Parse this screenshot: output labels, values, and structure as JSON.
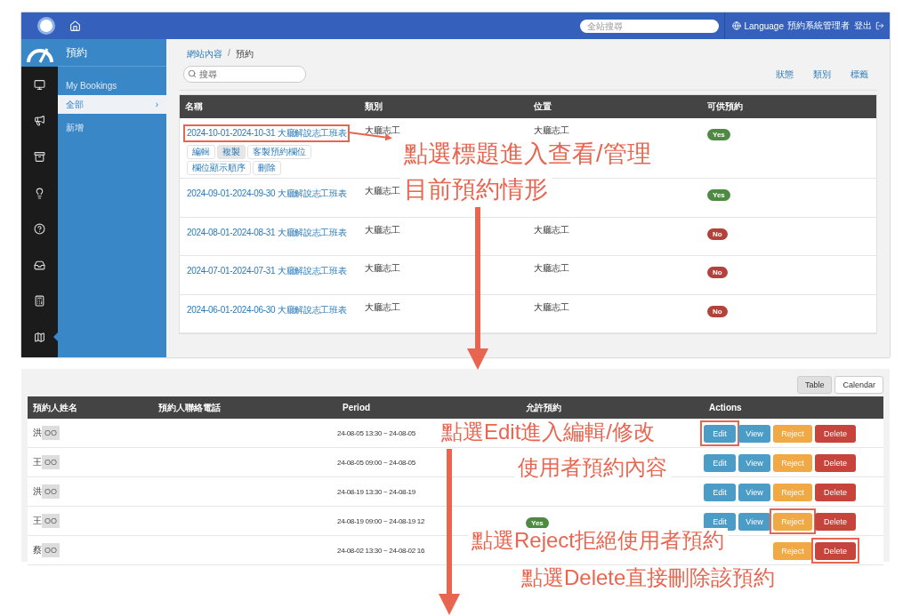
{
  "top_bar": {
    "search": {
      "placeholder": "全站搜尋"
    },
    "language": "Language",
    "user": "預約系統管理者",
    "logout": "登出"
  },
  "rail": {
    "items": [
      {
        "kind": "monitor",
        "selected": false
      },
      {
        "kind": "megaphone",
        "selected": false
      },
      {
        "kind": "archive",
        "selected": false
      },
      {
        "kind": "bulb",
        "selected": false
      },
      {
        "kind": "help",
        "selected": false
      },
      {
        "kind": "inbox",
        "selected": false
      },
      {
        "kind": "calculator",
        "selected": false
      },
      {
        "kind": "map",
        "selected": true
      }
    ]
  },
  "sidebar": {
    "title": "預約",
    "items": [
      {
        "label": "My Bookings",
        "selected": false
      },
      {
        "label": "全部",
        "selected": true,
        "arrow": "›"
      },
      {
        "label": "新增",
        "selected": false
      }
    ]
  },
  "breadcrumb": {
    "items": [
      "網站內容",
      "預約"
    ],
    "separator": "/"
  },
  "search": {
    "placeholder": "搜尋"
  },
  "filters": [
    "狀態",
    "類別",
    "標籤"
  ],
  "resource_table": {
    "columns": [
      "名稱",
      "類別",
      "位置",
      "可供預約"
    ],
    "rows": [
      {
        "name": "2024-10-01-2024-10-31 大廳解說志工班表",
        "highlighted": true,
        "actions": [
          "編輯",
          "複製",
          "客製預約欄位",
          "欄位顯示順序",
          "刪除"
        ],
        "category": "大廳志工",
        "location": "大廳志工",
        "available": {
          "label": "Yes",
          "on": true
        }
      },
      {
        "name": "2024-09-01-2024-09-30 大廳解說志工班表",
        "highlighted": false,
        "category": "大廳志工",
        "available": {
          "label": "Yes",
          "on": true
        }
      },
      {
        "name": "2024-08-01-2024-08-31 大廳解說志工班表",
        "highlighted": false,
        "category": "大廳志工",
        "location": "大廳志工",
        "available": {
          "label": "No",
          "on": false
        }
      },
      {
        "name": "2024-07-01-2024-07-31 大廳解說志工班表",
        "highlighted": false,
        "category": "大廳志工",
        "location": "大廳志工",
        "available": {
          "label": "No",
          "on": false
        }
      },
      {
        "name": "2024-06-01-2024-06-30 大廳解說志工班表",
        "highlighted": false,
        "category": "大廳志工",
        "location": "大廳志工",
        "available": {
          "label": "No",
          "on": false
        }
      }
    ]
  },
  "view_toggle": [
    {
      "label": "Table",
      "selected": true
    },
    {
      "label": "Calendar",
      "selected": false
    }
  ],
  "booking_table": {
    "columns": [
      "預約人姓名",
      "預約人聯絡電話",
      "Period",
      "允許預約",
      "Actions"
    ],
    "rows": [
      {
        "name": "洪",
        "masked": "OO",
        "period": "24-08-05 13:30 ~ 24-08-05",
        "actions": [
          {
            "kind": "edit",
            "label": "Edit",
            "highlighted": true
          },
          {
            "kind": "view",
            "label": "View",
            "highlighted": false
          },
          {
            "kind": "reject",
            "label": "Reject",
            "highlighted": false
          },
          {
            "kind": "delete",
            "label": "Delete",
            "highlighted": false
          }
        ]
      },
      {
        "name": "王",
        "masked": "OO",
        "period": "24-08-05 09:00 ~ 24-08-05",
        "actions": [
          {
            "kind": "edit",
            "label": "Edit",
            "highlighted": false
          },
          {
            "kind": "view",
            "label": "View",
            "highlighted": false
          },
          {
            "kind": "reject",
            "label": "Reject",
            "highlighted": false
          },
          {
            "kind": "delete",
            "label": "Delete",
            "highlighted": false
          }
        ]
      },
      {
        "name": "洪",
        "masked": "OO",
        "period": "24-08-19 13:30 ~ 24-08-19",
        "actions": [
          {
            "kind": "edit",
            "label": "Edit",
            "highlighted": false
          },
          {
            "kind": "view",
            "label": "View",
            "highlighted": false
          },
          {
            "kind": "reject",
            "label": "Reject",
            "highlighted": false
          },
          {
            "kind": "delete",
            "label": "Delete",
            "highlighted": false
          }
        ]
      },
      {
        "name": "王",
        "masked": "OO",
        "period": "24-08-19 09:00 ~ 24-08-19 12",
        "allowed": "Yes",
        "actions": [
          {
            "kind": "edit",
            "label": "Edit",
            "highlighted": false
          },
          {
            "kind": "view",
            "label": "View",
            "highlighted": false
          },
          {
            "kind": "reject",
            "label": "Reject",
            "highlighted": true
          },
          {
            "kind": "delete",
            "label": "Delete",
            "highlighted": false
          }
        ]
      },
      {
        "name": "蔡",
        "masked": "OO",
        "period": "24-08-02 13:30 ~ 24-08-02 16",
        "actions": [
          {
            "kind": "reject",
            "label": "Reject",
            "highlighted": false
          },
          {
            "kind": "delete",
            "label": "Delete",
            "highlighted": true
          }
        ]
      }
    ]
  },
  "annotations": [
    {
      "text": "點選標題進入查看/管理"
    },
    {
      "text": "目前預約情形"
    },
    {
      "text": "點選Edit進入編輯/修改"
    },
    {
      "text": "使用者預約內容"
    },
    {
      "text": "點選Reject拒絕使用者預約"
    },
    {
      "text": "點選Delete直接刪除該預約"
    }
  ]
}
